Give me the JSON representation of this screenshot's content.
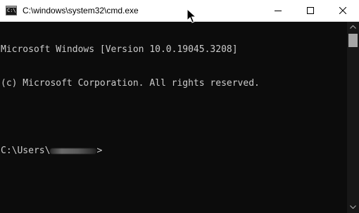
{
  "window": {
    "title": "C:\\windows\\system32\\cmd.exe",
    "icon": "cmd-icon",
    "caption_buttons": [
      "minimize-icon",
      "maximize-icon",
      "close-icon"
    ]
  },
  "console": {
    "lines": [
      "Microsoft Windows [Version 10.0.19045.3208]",
      "(c) Microsoft Corporation. All rights reserved.",
      "",
      "C:\\Users\\"
    ],
    "prompt_suffix": ">",
    "colors": {
      "background": "#0c0c0c",
      "text": "#cccccc"
    }
  }
}
